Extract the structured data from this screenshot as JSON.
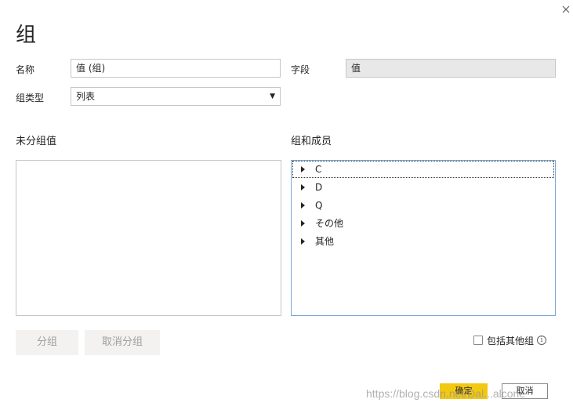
{
  "dialog": {
    "title": "组",
    "close_icon": "close-icon"
  },
  "form": {
    "name_label": "名称",
    "name_value": "值 (组)",
    "field_label": "字段",
    "field_value": "值",
    "group_type_label": "组类型",
    "group_type_value": "列表"
  },
  "ungrouped": {
    "label": "未分组值"
  },
  "groups": {
    "label": "组和成员",
    "items": [
      {
        "label": "C"
      },
      {
        "label": "D"
      },
      {
        "label": "Q"
      },
      {
        "label": "その他"
      },
      {
        "label": "其他"
      }
    ]
  },
  "actions": {
    "group_label": "分组",
    "ungroup_label": "取消分组",
    "include_other_label": "包括其他组",
    "include_other_checked": false
  },
  "footer": {
    "ok_label": "确定",
    "cancel_label": "取消"
  },
  "watermark": "https://blog.csdn.net/Dal...alcone"
}
